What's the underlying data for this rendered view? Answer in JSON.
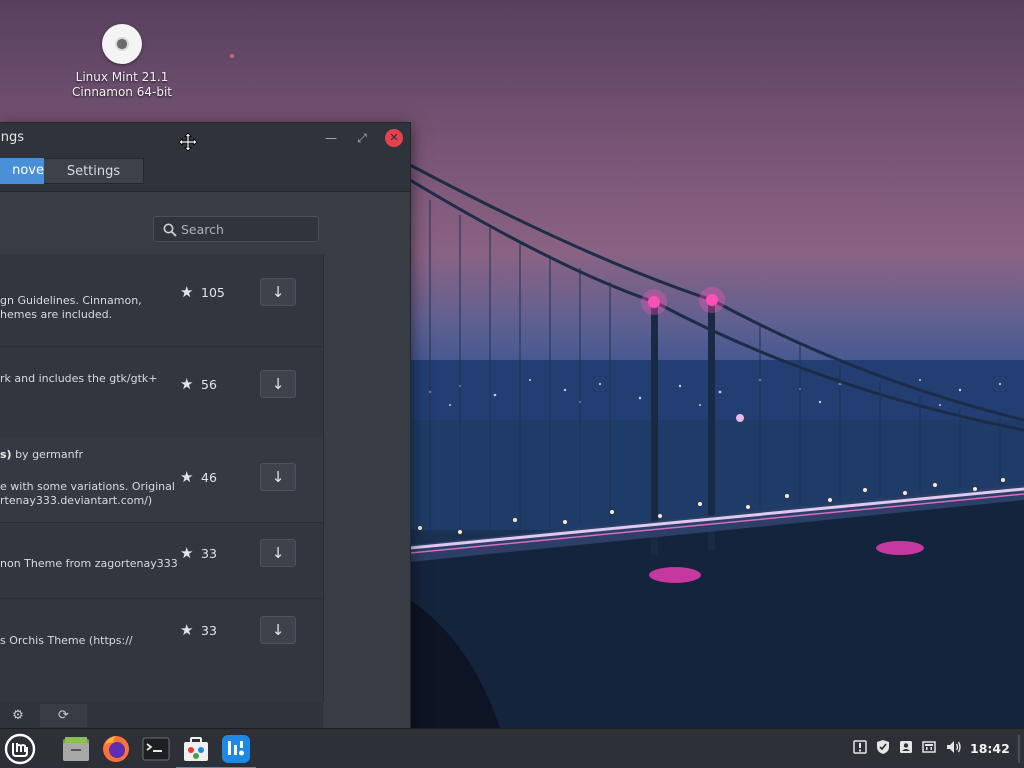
{
  "desktop": {
    "icon_label_line1": "Linux Mint 21.1",
    "icon_label_line2": "Cinnamon 64-bit"
  },
  "window": {
    "title": "ttings",
    "tabs": [
      {
        "label": "nove",
        "active": true
      },
      {
        "label": "Settings",
        "active": false
      }
    ],
    "search_placeholder": "Search",
    "items": [
      {
        "name": "",
        "author": "",
        "desc_line1": "gn Guidelines. Cinnamon,",
        "desc_line2": "hemes are included.",
        "desc_line3": "",
        "score": "105"
      },
      {
        "name": "",
        "author": "",
        "desc_line1": "rk and includes the gtk/gtk+",
        "desc_line2": "",
        "desc_line3": "",
        "score": "56"
      },
      {
        "name": "s)",
        "author": "by germanfr",
        "desc_line1": "e with some variations. Original",
        "desc_line2": "rtenay333.deviantart.com/)",
        "desc_line3": "",
        "score": "46"
      },
      {
        "name": "",
        "author": "",
        "desc_line1": "non Theme from zagortenay333",
        "desc_line2": "",
        "desc_line3": "",
        "score": "33"
      },
      {
        "name": "",
        "author": "",
        "desc_line1": "s Orchis Theme (https://",
        "desc_line2": "",
        "desc_line3": "",
        "score": "33"
      }
    ]
  },
  "taskbar": {
    "clock": "18:42",
    "active_color": "#4a90d9"
  },
  "colors": {
    "accent": "#4a90d9",
    "close": "#e2434f"
  }
}
